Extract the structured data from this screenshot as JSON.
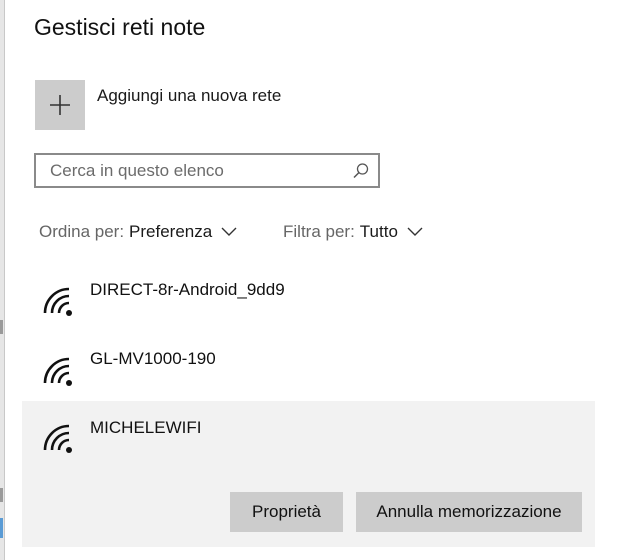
{
  "page": {
    "title": "Gestisci reti note"
  },
  "add_network": {
    "label": "Aggiungi una nuova rete",
    "icon": "plus-icon"
  },
  "search": {
    "placeholder": "Cerca in questo elenco",
    "value": "",
    "icon": "search-icon"
  },
  "sort": {
    "label": "Ordina per:",
    "value": "Preferenza"
  },
  "filter": {
    "label": "Filtra per:",
    "value": "Tutto"
  },
  "networks": [
    {
      "name": "DIRECT-8r-Android_9dd9",
      "icon": "wifi-icon",
      "selected": false
    },
    {
      "name": "GL-MV1000-190",
      "icon": "wifi-icon",
      "selected": false
    },
    {
      "name": "MICHELEWIFI",
      "icon": "wifi-icon",
      "selected": true
    }
  ],
  "actions": {
    "properties_label": "Proprietà",
    "forget_label": "Annulla memorizzazione"
  },
  "colors": {
    "button_bg": "#cccccc",
    "selected_bg": "#f2f2f2",
    "border": "#8a8a8a",
    "muted_text": "#666666"
  }
}
